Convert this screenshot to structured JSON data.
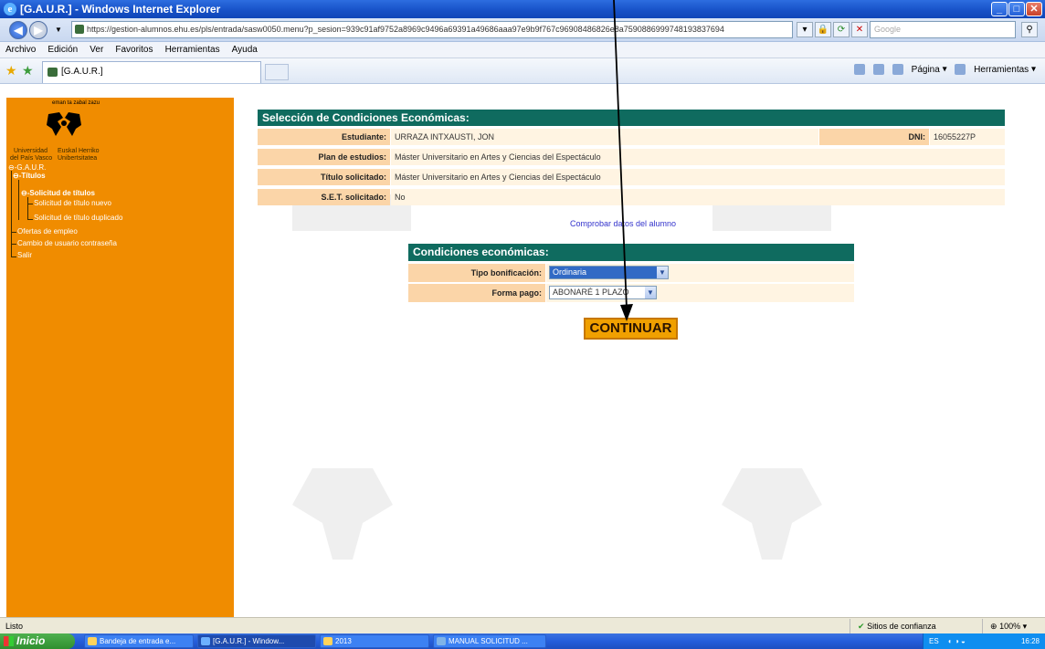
{
  "window": {
    "title": "[G.A.U.R.] - Windows Internet Explorer"
  },
  "address": {
    "url": "https://gestion-alumnos.ehu.es/pls/entrada/sasw0050.menu?p_sesion=939c91af9752a8969c9496a69391a49686aaa97e9b9f767c96908486826e8a7590886999748193837694",
    "search_placeholder": "Google"
  },
  "menu": [
    "Archivo",
    "Edición",
    "Ver",
    "Favoritos",
    "Herramientas",
    "Ayuda"
  ],
  "tab": {
    "title": "[G.A.U.R.]"
  },
  "ietools": {
    "page": "Página",
    "tools": "Herramientas"
  },
  "sidebar": {
    "logo_top": "eman ta zabal zazu",
    "uni_es_1": "Universidad",
    "uni_es_2": "del País Vasco",
    "uni_eu_1": "Euskal Herriko",
    "uni_eu_2": "Unibertsitatea",
    "items": [
      {
        "label": "G.A.U.R."
      },
      {
        "label": "Títulos"
      },
      {
        "label": "Solicitud de títulos"
      },
      {
        "label": "Solicitud de título nuevo"
      },
      {
        "label": "Solicitud de título duplicado"
      },
      {
        "label": "Ofertas de empleo"
      },
      {
        "label": "Cambio de usuario contraseña"
      },
      {
        "label": "Salir"
      }
    ]
  },
  "form": {
    "header": "Selección de Condiciones Económicas:",
    "estudiante_label": "Estudiante:",
    "estudiante_value": "URRAZA INTXAUSTI, JON",
    "dni_label": "DNI:",
    "dni_value": "16055227P",
    "plan_label": "Plan de estudios:",
    "plan_value": "Máster Universitario en Artes y Ciencias del Espectáculo",
    "titulo_label": "Título solicitado:",
    "titulo_value": "Máster Universitario en Artes y Ciencias del Espectáculo",
    "set_label": "S.E.T. solicitado:",
    "set_value": "No",
    "link": "Comprobar datos del alumno",
    "cond_header": "Condiciones económicas:",
    "tipo_label": "Tipo bonificación:",
    "tipo_value": "Ordinaria",
    "pago_label": "Forma pago:",
    "pago_value": "ABONARÉ 1 PLAZO",
    "submit": "CONTINUAR"
  },
  "status": {
    "left": "Listo",
    "zone": "Sitios de confianza",
    "zoom": "100%"
  },
  "taskbar": {
    "start": "Inicio",
    "tasks": [
      "Bandeja de entrada e...",
      "[G.A.U.R.] - Window...",
      "2013",
      "MANUAL SOLICITUD ..."
    ],
    "lang": "ES",
    "clock": "16:28"
  },
  "colors": {
    "sidebar": "#f08c00",
    "header": "#0f6b5f",
    "label_bg": "#fbd5a8",
    "value_bg": "#fff4e2",
    "button": "#f0a000"
  }
}
